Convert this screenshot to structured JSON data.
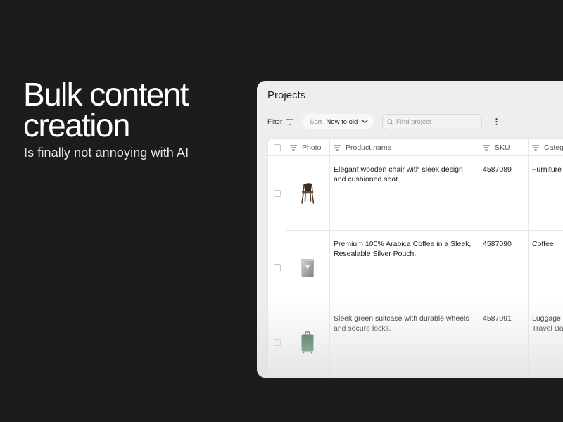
{
  "hero": {
    "title": "Bulk content\ncreation",
    "subtitle": "Is finally not annoying with AI"
  },
  "panel": {
    "title": "Projects",
    "toolbar": {
      "filter_label": "Filter",
      "sort_label": "Sort",
      "sort_value": "New to old",
      "search_placeholder": "Find project"
    },
    "table": {
      "columns": {
        "photo": "Photo",
        "name": "Product name",
        "sku": "SKU",
        "category": "Categ"
      },
      "rows": [
        {
          "name": "Elegant wooden chair with sleek design and cushioned seat.",
          "sku": "4587089",
          "category": "Furniture",
          "photo_icon": "chair-photo"
        },
        {
          "name": "Premium 100% Arabica Coffee in a Sleek, Resealable Silver Pouch.",
          "sku": "4587090",
          "category": "Coffee",
          "photo_icon": "coffee-pouch-photo"
        },
        {
          "name": "Sleek green suitcase with durable wheels and secure locks.",
          "sku": "4587091",
          "category": "Luggage &\nTravel Bag",
          "photo_icon": "suitcase-photo"
        }
      ]
    }
  },
  "colors": {
    "background": "#1c1c1c",
    "panel": "#eeeeee",
    "suitcase_green": "#1f5b3a"
  }
}
